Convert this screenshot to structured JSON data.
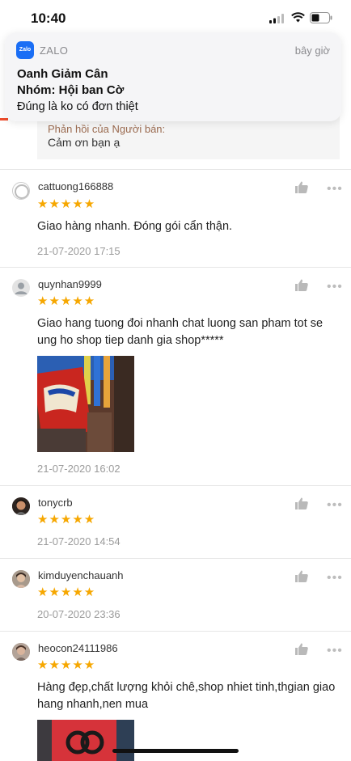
{
  "status_bar": {
    "time": "10:40"
  },
  "notification": {
    "app_icon_text": "Zalo",
    "app_name": "ZALO",
    "time": "bây giờ",
    "title_line1": "Oanh Giảm Cân",
    "title_line2": "Nhóm: Hội ban Cờ",
    "message": "Đúng là ko có đơn thiệt"
  },
  "seller_reply": {
    "label": "Phản hồi của Người bán:",
    "text": "Cảm ơn bạn ạ"
  },
  "reviews": [
    {
      "username": "cattuong166888",
      "stars": "★★★★★",
      "rating": 5,
      "text": "Giao hàng nhanh. Đóng gói cẩn thận.",
      "date": "21-07-2020 17:15"
    },
    {
      "username": "quynhan9999",
      "stars": "★★★★★",
      "rating": 5,
      "text": "Giao hang tuong đoi nhanh chat luong san pham tot se ung ho shop tiep danh gia shop*****",
      "date": "21-07-2020 16:02"
    },
    {
      "username": "tonycrb",
      "stars": "★★★★★",
      "rating": 5,
      "date": "21-07-2020 14:54"
    },
    {
      "username": "kimduyenchauanh",
      "stars": "★★★★★",
      "rating": 5,
      "date": "20-07-2020 23:36"
    },
    {
      "username": "heocon24111986",
      "stars": "★★★★★",
      "rating": 5,
      "text": "Hàng đẹp,chất lượng khỏi chê,shop nhiet tinh,thgian giao hang nhanh,nen mua"
    }
  ],
  "icons": {
    "like": "thumbs-up-icon",
    "more": "more-dots-icon"
  },
  "colors": {
    "star": "#f6a700",
    "accent": "#ee4d2d"
  }
}
